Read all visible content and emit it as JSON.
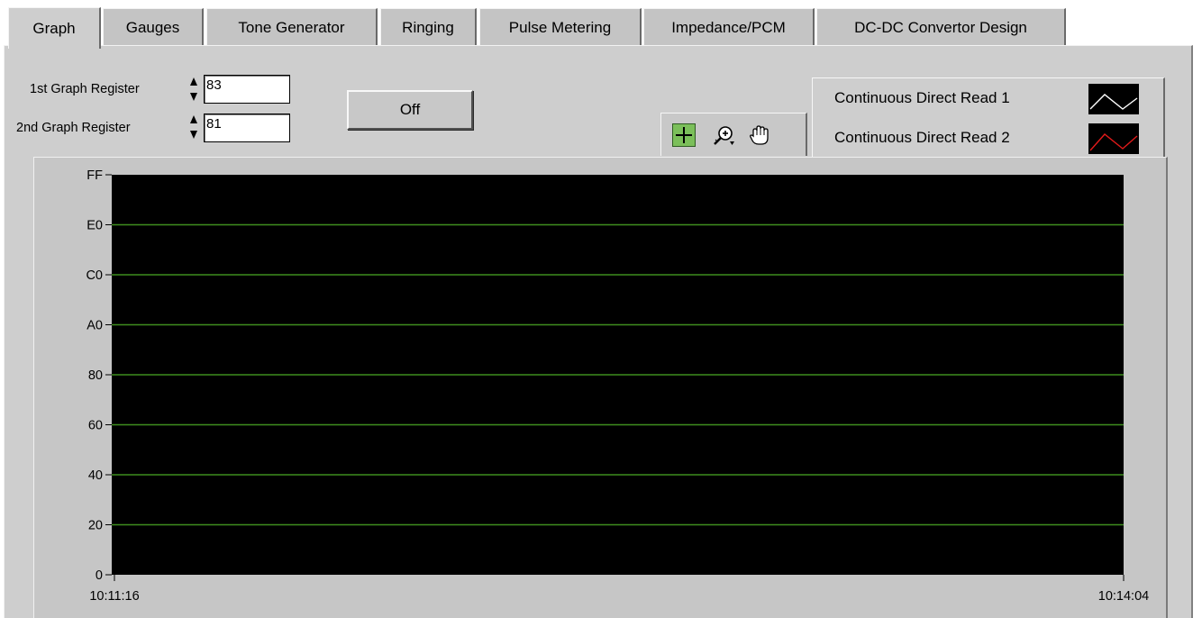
{
  "tabs": [
    {
      "label": "Graph",
      "active": true
    },
    {
      "label": "Gauges",
      "active": false
    },
    {
      "label": "Tone Generator",
      "active": false
    },
    {
      "label": "Ringing",
      "active": false
    },
    {
      "label": "Pulse Metering",
      "active": false
    },
    {
      "label": "Impedance/PCM",
      "active": false
    },
    {
      "label": "DC-DC Convertor Design",
      "active": false
    }
  ],
  "controls": {
    "reg1_label": "1st Graph Register",
    "reg1_value": "83",
    "reg2_label": "2nd Graph Register",
    "reg2_value": "81",
    "off_button": "Off"
  },
  "tools": [
    "cursor-tool-icon",
    "zoom-tool-icon",
    "pan-hand-icon"
  ],
  "legend": [
    {
      "label": "Continuous Direct Read 1",
      "color": "#ffffff"
    },
    {
      "label": "Continuous Direct Read 2",
      "color": "#e21a1a"
    }
  ],
  "chart_data": {
    "type": "line",
    "plot_background": "#000000",
    "grid_color": "#3e8d1e",
    "y_ticks": [
      "FF",
      "E0",
      "C0",
      "A0",
      "80",
      "60",
      "40",
      "20",
      "0"
    ],
    "ylim": [
      0,
      255
    ],
    "x_ticks": [
      "10:11:16",
      "10:14:04"
    ],
    "series": [
      {
        "name": "Continuous Direct Read 1",
        "values": []
      },
      {
        "name": "Continuous Direct Read 2",
        "values": []
      }
    ],
    "grid": true
  }
}
